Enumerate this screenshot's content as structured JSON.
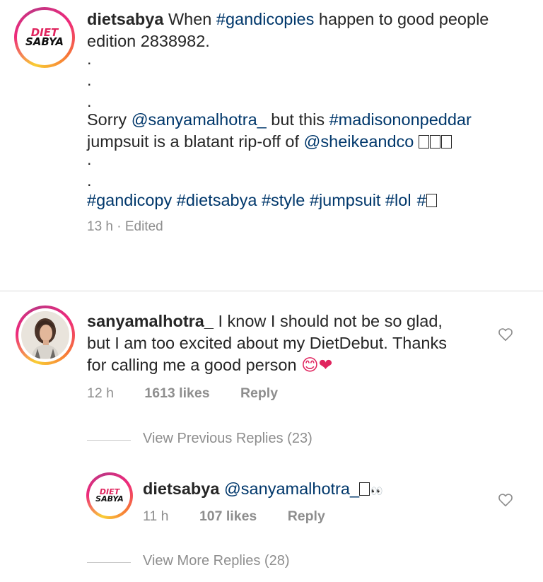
{
  "post": {
    "username": "dietsabya",
    "avatar_text_top": "DIET",
    "avatar_text_bottom": "SABYA",
    "text_1": "When",
    "tag_1": "#gandicopies",
    "text_2": "happen to good people edition 2838982.",
    "dots": [
      ".",
      ".",
      "."
    ],
    "text_3": "Sorry",
    "mention_1": "@sanyamalhotra_",
    "text_4": "but this",
    "tag_2": "#madisononpeddar",
    "text_5": "jumpsuit is a blatant rip-off of",
    "mention_2": "@sheikeandco",
    "dots_2": [
      ".",
      "."
    ],
    "hashtags": [
      "#gandicopy",
      "#dietsabya",
      "#style",
      "#jumpsuit",
      "#lol",
      "#"
    ],
    "timestamp": "13 h · Edited"
  },
  "comment": {
    "username": "sanyamalhotra_",
    "text": "I know I should not be so glad, but I am too excited about my DietDebut. Thanks for calling me a good person",
    "emoji": "😊❤",
    "time": "12 h",
    "likes": "1613 likes",
    "reply_label": "Reply"
  },
  "view_previous": "View Previous Replies (23)",
  "reply": {
    "username": "dietsabya",
    "mention": "@sanyamalhotra_",
    "emoji": "👀",
    "time": "11 h",
    "likes": "107 likes",
    "reply_label": "Reply"
  },
  "view_more": "View More Replies (28)",
  "colors": {
    "link": "#00376b",
    "muted": "#8e8e8e",
    "text": "#262626",
    "heart_red": "#e0245e"
  }
}
